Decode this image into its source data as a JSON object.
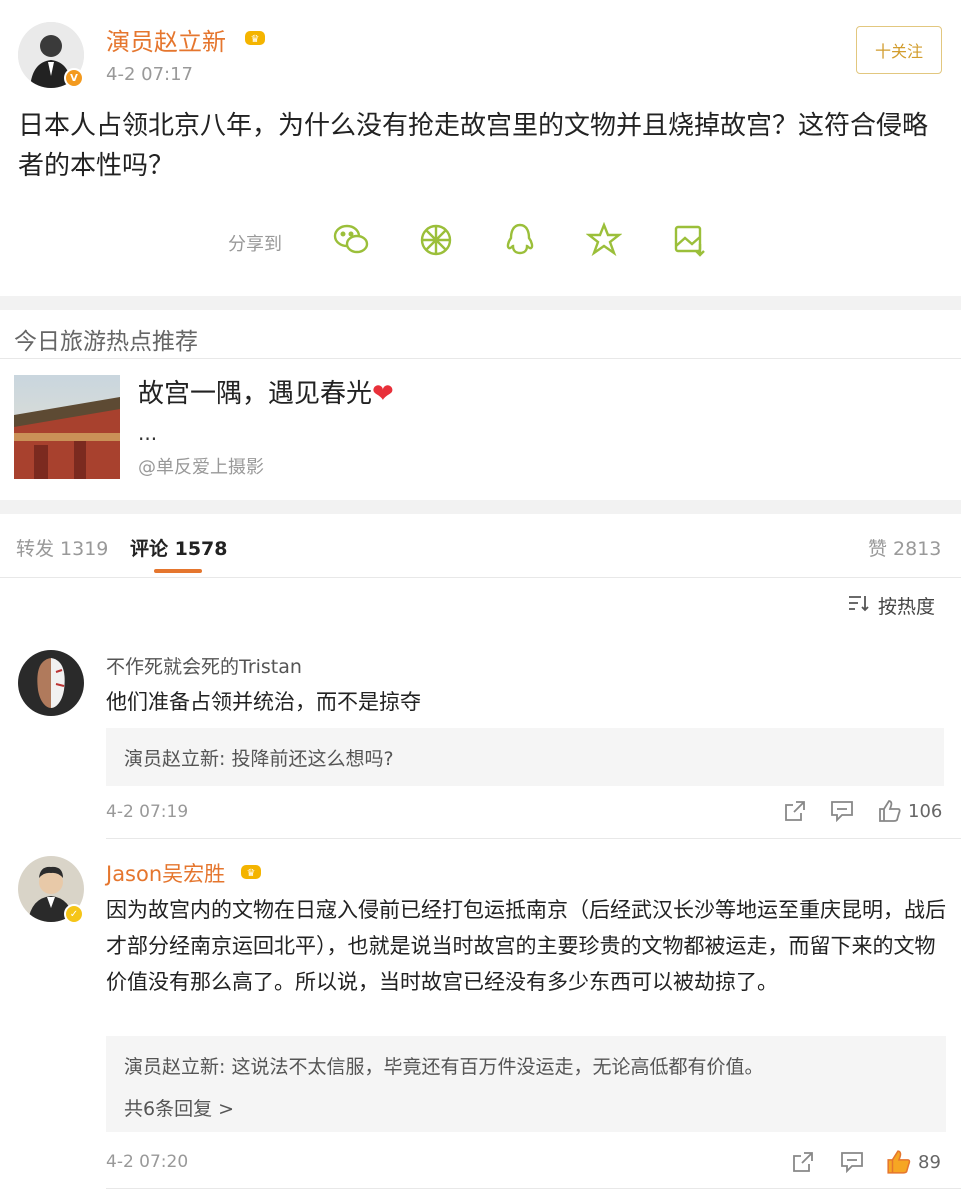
{
  "post": {
    "author": "演员赵立新",
    "time": "4-2 07:17",
    "follow_label": "十关注",
    "text": "日本人占领北京八年，为什么没有抢走故宫里的文物并且烧掉故宫？这符合侵略者的本性吗？",
    "share_label": "分享到",
    "share_icons": [
      "wechat-icon",
      "moments-icon",
      "qq-icon",
      "qzone-icon",
      "save-image-icon"
    ]
  },
  "recommend": {
    "header": "今日旅游热点推荐",
    "title": "故宫一隅，遇见春光",
    "ellipsis": "...",
    "source": "@单反爱上摄影"
  },
  "tabs": {
    "repost": "转发 1319",
    "comments": "评论 1578",
    "likes": "赞 2813",
    "active_color": "#e5762e"
  },
  "sort_label": "按热度",
  "comments": [
    {
      "author": "不作死就会死的Tristan",
      "text": "他们准备占领并统治，而不是掠夺",
      "reply": "演员赵立新: 投降前还这么想吗?",
      "time": "4-2 07:19",
      "likes": "106"
    },
    {
      "author": "Jason吴宏胜",
      "text": "因为故宫内的文物在日寇入侵前已经打包运抵南京（后经武汉长沙等地运至重庆昆明，战后才部分经南京运回北平），也就是说当时故宫的主要珍贵的文物都被运走，而留下来的文物价值没有那么高了。所以说，当时故宫已经没有多少东西可以被劫掠了。",
      "reply": "演员赵立新: 这说法不太信服，毕竟还有百万件没运走，无论高低都有价值。",
      "more_replies": "共6条回复 >",
      "time": "4-2 07:20",
      "likes": "89"
    }
  ],
  "colors": {
    "username": "#e5762e",
    "share_icon": "#9bbf3a",
    "heart": "#e8303a"
  }
}
